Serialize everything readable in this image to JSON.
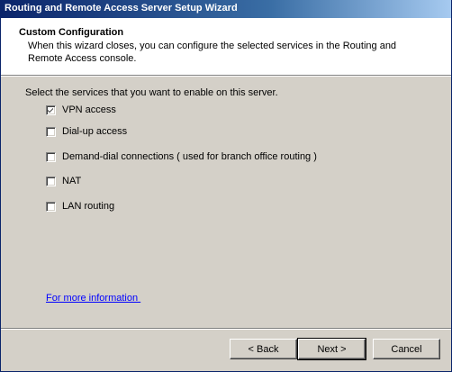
{
  "window": {
    "title": "Routing and Remote Access Server Setup Wizard"
  },
  "header": {
    "title": "Custom Configuration",
    "description": "When this wizard closes, you can configure the selected services in the Routing and Remote Access console."
  },
  "main": {
    "prompt": "Select the services that you want to enable on this server.",
    "options": [
      {
        "label": "VPN access",
        "checked": true
      },
      {
        "label": "Dial-up access",
        "checked": false
      },
      {
        "label": "Demand-dial connections ( used for branch office routing )",
        "checked": false
      },
      {
        "label": "NAT",
        "checked": false
      },
      {
        "label": "LAN routing",
        "checked": false
      }
    ],
    "link": "For more information "
  },
  "footer": {
    "back_label": "< Back",
    "next_label": "Next >",
    "cancel_label": "Cancel"
  }
}
